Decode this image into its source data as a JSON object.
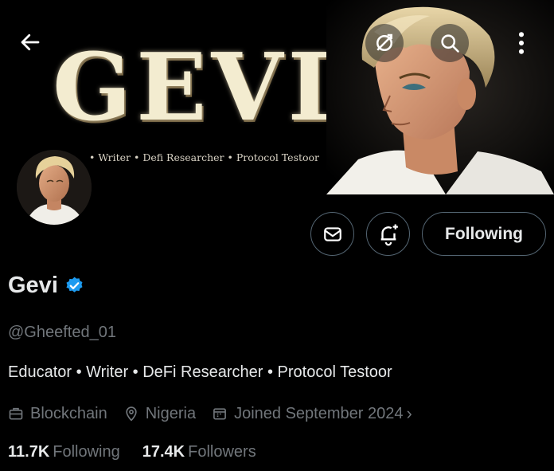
{
  "banner": {
    "title": "GEVI",
    "tagline": "• Writer • Defi Researcher • Protocol Testoor"
  },
  "topbar": {
    "back_icon": "arrow-left-icon",
    "sync_icon": "sync-icon",
    "search_icon": "search-icon",
    "more_icon": "more-vertical-icon"
  },
  "actions": {
    "message_icon": "envelope-icon",
    "notify_icon": "bell-plus-icon",
    "following_label": "Following"
  },
  "profile": {
    "display_name": "Gevi",
    "verified": true,
    "handle": "@Gheefted_01",
    "bio": "Educator • Writer • DeFi Researcher • Protocol Testoor",
    "category": "Blockchain",
    "location": "Nigeria",
    "joined": "Joined September 2024",
    "chevron": "›"
  },
  "stats": {
    "following_count": "11.7K",
    "following_label": "Following",
    "followers_count": "17.4K",
    "followers_label": "Followers"
  },
  "colors": {
    "background": "#000000",
    "text_primary": "#e7e9ea",
    "text_secondary": "#71767b",
    "border": "#536471",
    "verified_blue": "#1d9bf0"
  }
}
